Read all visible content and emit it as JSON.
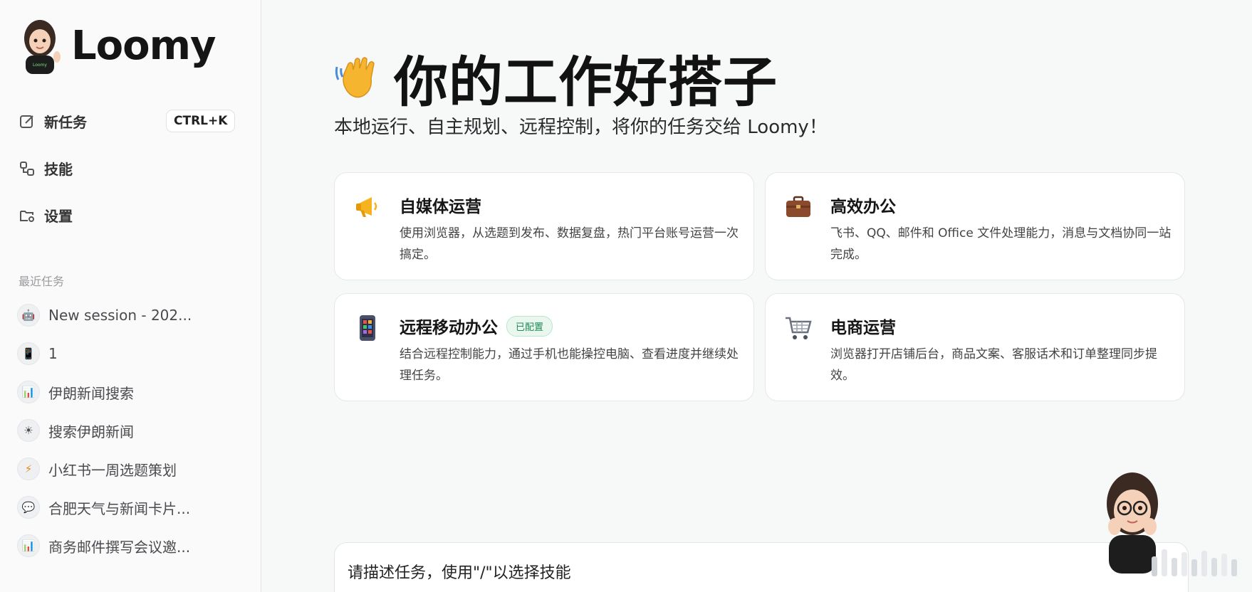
{
  "brand": {
    "name": "Loomy"
  },
  "nav": {
    "new_task": "新任务",
    "shortcut": "CTRL+K",
    "skills": "技能",
    "settings": "设置"
  },
  "recent": {
    "title": "最近任务",
    "items": [
      {
        "icon": "robot-icon",
        "label": "New session - 202..."
      },
      {
        "icon": "phone-icon",
        "label": "1"
      },
      {
        "icon": "bar-chart-icon",
        "label": "伊朗新闻搜索"
      },
      {
        "icon": "sun-icon",
        "label": "搜索伊朗新闻"
      },
      {
        "icon": "lightning-icon",
        "label": "小红书一周选题策划"
      },
      {
        "icon": "speech-bubble-icon",
        "label": "合肥天气与新闻卡片..."
      },
      {
        "icon": "bar-chart-icon",
        "label": "商务邮件撰写会议邀..."
      }
    ]
  },
  "hero": {
    "title": "你的工作好搭子",
    "subtitle": "本地运行、自主规划、远程控制，将你的任务交给 Loomy！"
  },
  "cards": {
    "media": {
      "title": "自媒体运营",
      "desc": "使用浏览器，从选题到发布、数据复盘，热门平台账号运营一次搞定。",
      "icon": "megaphone-icon"
    },
    "office": {
      "title": "高效办公",
      "desc": "飞书、QQ、邮件和 Office 文件处理能力，消息与文档协同一站完成。",
      "icon": "briefcase-icon"
    },
    "remote": {
      "title": "远程移动办公",
      "badge": "已配置",
      "desc": "结合远程控制能力，通过手机也能操控电脑、查看进度并继续处理任务。",
      "icon": "phone-icon"
    },
    "ecommerce": {
      "title": "电商运营",
      "desc": "浏览器打开店铺后台，商品文案、客服话术和订单整理同步提效。",
      "icon": "shopping-cart-icon"
    }
  },
  "composer": {
    "placeholder": "请描述任务，使用\"/\"以选择技能"
  },
  "colors": {
    "accent_green": "#1e8a55",
    "background": "#f7f8f8"
  }
}
